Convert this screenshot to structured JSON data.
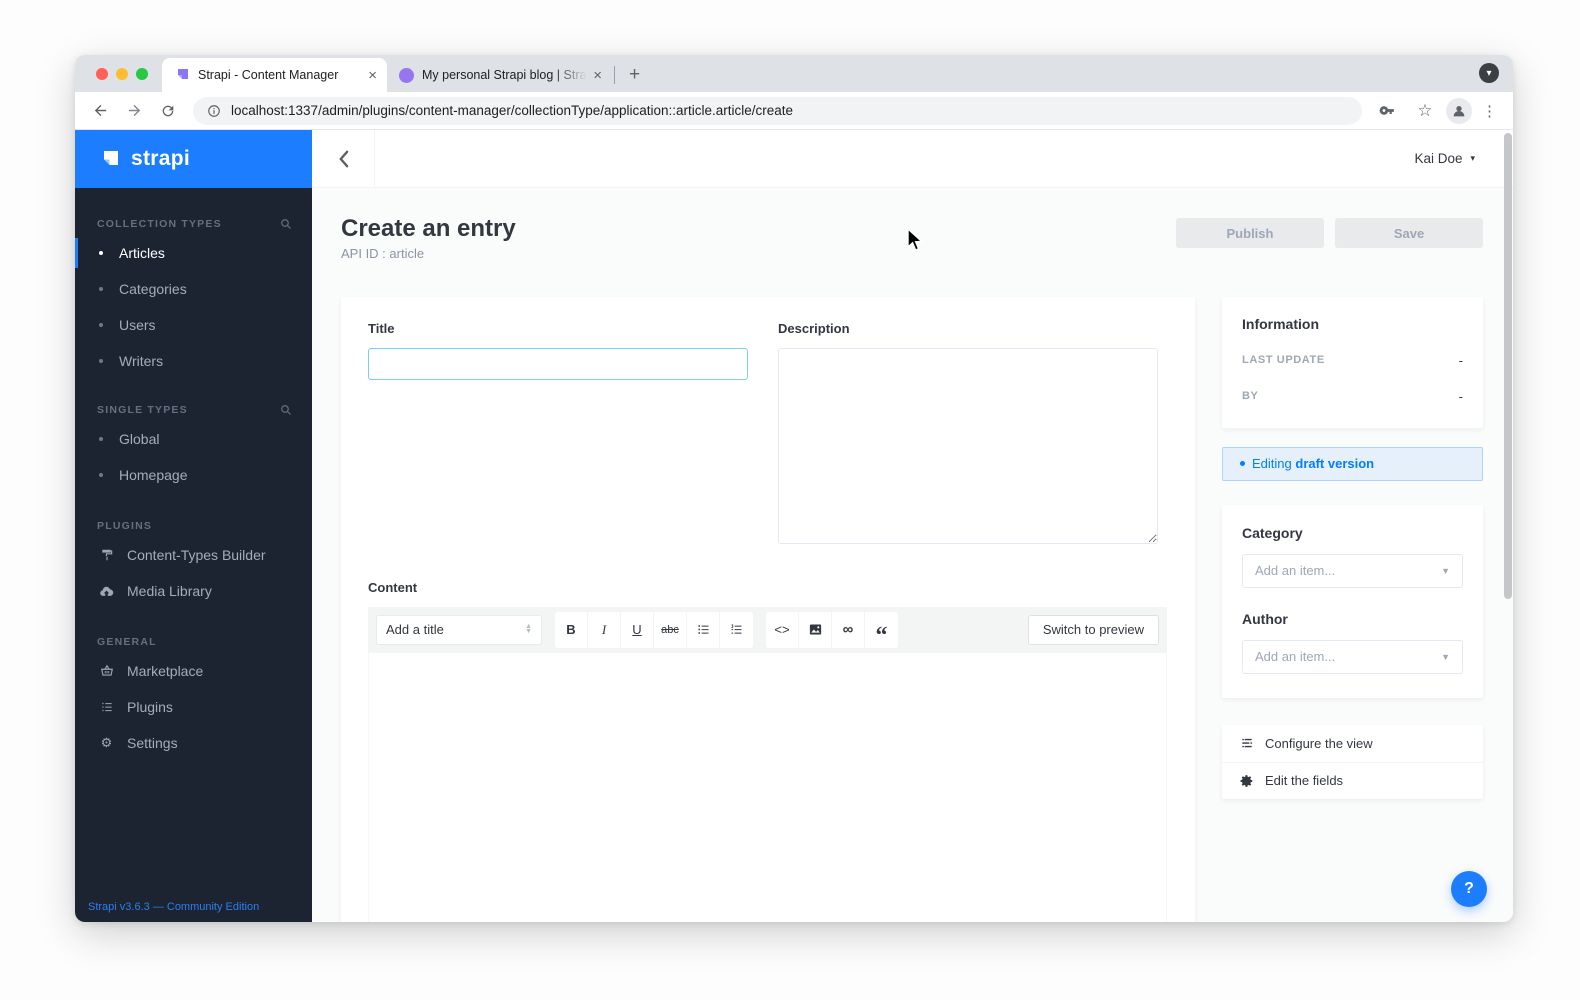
{
  "browser": {
    "tab1": {
      "title": "Strapi - Content Manager"
    },
    "tab2": {
      "title": "My personal Strapi blog | Strap"
    },
    "close_glyph": "×",
    "new_tab_glyph": "+",
    "tab_search_glyph": "▾",
    "url": "localhost:1337/admin/plugins/content-manager/collectionType/application::article.article/create",
    "kebab_glyph": "⋮",
    "star_glyph": "☆"
  },
  "sidebar": {
    "logo": "strapi",
    "collection_types": {
      "label": "COLLECTION TYPES",
      "items": [
        "Articles",
        "Categories",
        "Users",
        "Writers"
      ]
    },
    "single_types": {
      "label": "SINGLE TYPES",
      "items": [
        "Global",
        "Homepage"
      ]
    },
    "plugins_section": {
      "label": "PLUGINS",
      "items": [
        "Content-Types Builder",
        "Media Library"
      ]
    },
    "general_section": {
      "label": "GENERAL",
      "items": [
        "Marketplace",
        "Plugins",
        "Settings"
      ]
    },
    "settings_glyph": "⚙",
    "footer": "Strapi v3.6.3 — Community Edition"
  },
  "header": {
    "user": "Kai Doe",
    "chevron": "▾"
  },
  "page": {
    "title": "Create an entry",
    "subtitle": "API ID : article",
    "publish": "Publish",
    "save": "Save"
  },
  "form": {
    "title_label": "Title",
    "title_value": "",
    "description_label": "Description",
    "description_value": "",
    "content_label": "Content",
    "heading_placeholder": "Add a title",
    "switch_preview": "Switch to preview",
    "toolbar_glyphs": {
      "bold": "B",
      "italic": "I",
      "underline": "U",
      "strike": "abc",
      "code": "<>",
      "link": "∞",
      "quote": "“"
    }
  },
  "rail": {
    "info_title": "Information",
    "last_update_label": "LAST UPDATE",
    "last_update_value": "-",
    "by_label": "BY",
    "by_value": "-",
    "draft_prefix": "Editing",
    "draft_bold": "draft version",
    "category_label": "Category",
    "category_placeholder": "Add an item...",
    "author_label": "Author",
    "author_placeholder": "Add an item...",
    "configure_view": "Configure the view",
    "edit_fields": "Edit the fields",
    "help_glyph": "?"
  },
  "colors": {
    "brand_blue": "#1c7eff",
    "sidebar_bg": "#1c2431",
    "draft_bg": "#e6f0fb",
    "draft_border": "#aed4fb",
    "focus_border": "#78caff"
  }
}
